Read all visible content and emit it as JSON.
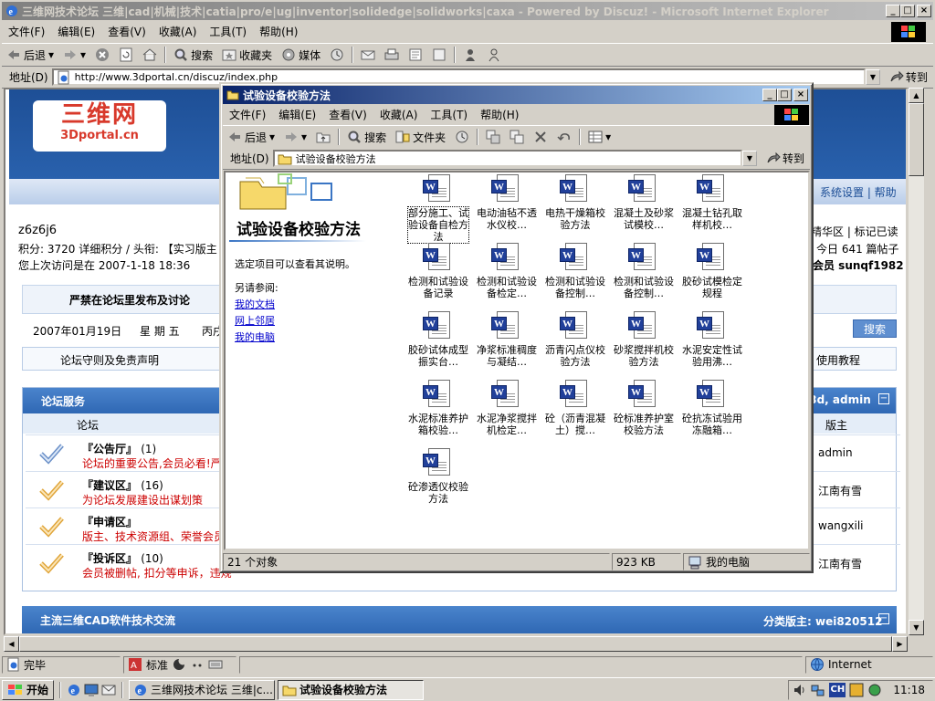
{
  "ie": {
    "title": "三维网技术论坛 三维|cad|机械|技术|catia|pro/e|ug|inventor|solidedge|solidworks|caxa - Powered by Discuz! - Microsoft Internet Explorer",
    "menu": [
      "文件(F)",
      "编辑(E)",
      "查看(V)",
      "收藏(A)",
      "工具(T)",
      "帮助(H)"
    ],
    "toolbar": {
      "back": "后退",
      "search": "搜索",
      "favorites": "收藏夹",
      "media": "媒体"
    },
    "address_label": "地址(D)",
    "address": "http://www.3dportal.cn/discuz/index.php",
    "go": "转到",
    "status": {
      "done": "完毕",
      "zone": "Internet"
    }
  },
  "forum": {
    "logo_cn": "三维网",
    "logo_en": "3Dportal.cn",
    "nav_right": "系统设置 | 帮助",
    "username": "z6z6j6",
    "points_line": "积分: 3720 详细积分 / 头衔: 【实习版主",
    "last_visit": "您上次访问是在 2007-1-18 18:36",
    "right_1": "精华区 | 标记已读",
    "right_2": "今日 641 篇帖子",
    "right_3": "会员 sunqf1982",
    "notice": "严禁在论坛里发布及讨论",
    "date": "2007年01月19日",
    "weekday": "星 期 五",
    "date_extra": "丙戌",
    "search_btn": "搜索",
    "rules_link": "论坛守则及免责声明",
    "tutorial_link": "使用教程",
    "service_title": "论坛服务",
    "service_mods": "o3d, admin",
    "col_forum": "论坛",
    "col_mod": "版主",
    "boards": [
      {
        "name": "『公告厅』",
        "count": "(1)",
        "desc": "论坛的重要公告,会员必看!严禁",
        "mod": "admin"
      },
      {
        "name": "『建议区』",
        "count": "(16)",
        "desc": "为论坛发展建设出谋划策",
        "mod": "江南有雪"
      },
      {
        "name": "『申请区』",
        "count": "",
        "desc": "版主、技术资源组、荣誉会员",
        "mod": "wangxili"
      },
      {
        "name": "『投诉区』",
        "count": "(10)",
        "desc": "会员被删帖, 扣分等申诉，违规",
        "mod": "江南有雪"
      }
    ],
    "section2_title": "主流三维CAD软件技术交流",
    "section2_mods": "分类版主: wei820512"
  },
  "explorer": {
    "title": "试验设备校验方法",
    "menu": [
      "文件(F)",
      "编辑(E)",
      "查看(V)",
      "收藏(A)",
      "工具(T)",
      "帮助(H)"
    ],
    "toolbar": {
      "back": "后退",
      "search": "搜索",
      "folders": "文件夹"
    },
    "address_label": "地址(D)",
    "address": "试验设备校验方法",
    "go": "转到",
    "panel_title": "试验设备校验方法",
    "panel_hint": "选定项目可以查看其说明。",
    "see_also": "另请参阅:",
    "links": [
      "我的文档",
      "网上邻居",
      "我的电脑"
    ],
    "files": [
      "部分施工、试验设备自检方法",
      "电动油毡不透水仪校…",
      "电热干燥箱校验方法",
      "混凝土及砂浆试模校…",
      "混凝土钻孔取样机校…",
      "检测和试验设备记录",
      "检测和试验设备检定…",
      "检测和试验设备控制…",
      "检测和试验设备控制…",
      "胶砂试模检定规程",
      "胶砂试体成型振实台…",
      "净浆标准稠度与凝结…",
      "沥青闪点仪校验方法",
      "砂浆搅拌机校验方法",
      "水泥安定性试验用沸…",
      "水泥标准养护箱校验…",
      "水泥净浆搅拌机检定…",
      "砼（沥青混凝土）搅…",
      "砼标准养护室校验方法",
      "砼抗冻试验用冻融箱…",
      "砼渗透仪校验方法"
    ],
    "status": {
      "count": "21 个对象",
      "size": "923 KB",
      "location": "我的电脑"
    }
  },
  "taskbar": {
    "start": "开始",
    "tasks": [
      "三维网技术论坛 三维|c...",
      "试验设备校验方法"
    ],
    "clock": "11:18",
    "ime": "标准"
  }
}
